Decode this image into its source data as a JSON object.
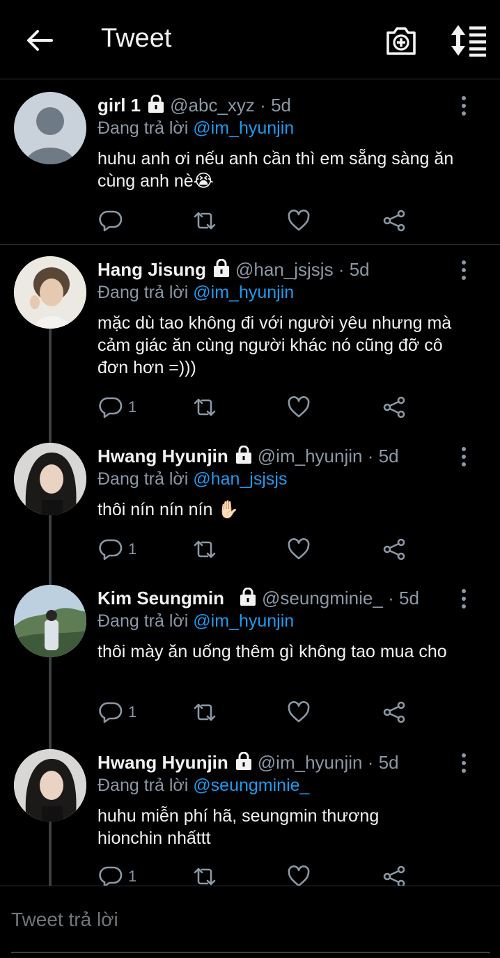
{
  "header": {
    "title": "Tweet",
    "back_icon": "arrow-left-icon",
    "camera_icon": "add-photo-icon",
    "sort_icon": "sort-icon"
  },
  "tweets": [
    {
      "name": "girl 1",
      "handle": "@abc_xyz",
      "dot": "·",
      "time": "5d",
      "replying_label": "Đang trả lời",
      "replying_to": "@im_hyunjin",
      "text": "huhu anh ơi nếu anh cần thì em sẵng sàng ăn cùng anh nè😭",
      "reply_count": "",
      "avatar": "default-avatar"
    },
    {
      "name": "Hang Jisung",
      "handle": "@han_jsjsjs",
      "dot": "·",
      "time": "5d",
      "replying_label": "Đang trả lời",
      "replying_to": "@im_hyunjin",
      "text": "mặc dù tao không đi với người yêu nhưng mà cảm giác ăn cùng người khác nó cũng đỡ cô đơn hơn =)))",
      "reply_count": "1",
      "avatar": "photo-avatar"
    },
    {
      "name": "Hwang Hyunjin",
      "handle": "@im_hyunjin",
      "dot": "·",
      "time": "5d",
      "replying_label": "Đang trả lời",
      "replying_to": "@han_jsjsjs",
      "text": "thôi nín nín nín ✋🏻",
      "reply_count": "1",
      "avatar": "photo-avatar"
    },
    {
      "name": "Kim Seungmin",
      "handle": "@seungminie_",
      "dot": "·",
      "time": "5d",
      "replying_label": "Đang trả lời",
      "replying_to": "@im_hyunjin",
      "text": "thôi mày ăn uống thêm gì không tao mua cho",
      "reply_count": "1",
      "avatar": "photo-avatar"
    },
    {
      "name": "Hwang Hyunjin",
      "handle": "@im_hyunjin",
      "dot": "·",
      "time": "5d",
      "replying_label": "Đang trả lời",
      "replying_to": "@seungminie_",
      "text": "huhu miễn phí hã, seungmin thương hionchin nhấttt",
      "reply_count": "1",
      "avatar": "photo-avatar"
    }
  ],
  "compose": {
    "placeholder": "Tweet trả lời"
  },
  "colors": {
    "background": "#000000",
    "accent": "#1d9bf0",
    "muted": "#8b98a5",
    "divider": "#2f3336"
  }
}
